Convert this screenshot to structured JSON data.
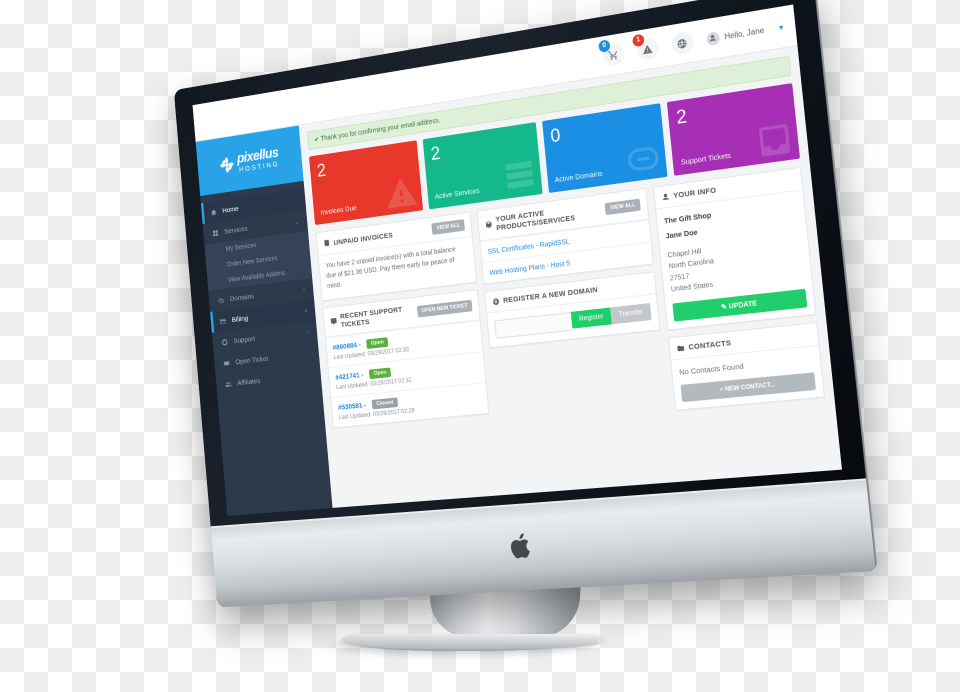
{
  "brand": {
    "name": "pixellus",
    "suffix": "HOSTING",
    "icon": "flower-icon"
  },
  "topbar": {
    "cart": {
      "icon": "shopping-cart-icon",
      "badge": "0"
    },
    "alerts": {
      "icon": "warning-triangle-icon",
      "badge": "1"
    },
    "globe": {
      "icon": "globe-icon"
    },
    "user": {
      "avatar_icon": "user-avatar-icon",
      "greeting": "Hello, Jane",
      "caret": "▾"
    },
    "hamburger": {
      "icon": "hamburger-menu-icon"
    }
  },
  "sidebar": {
    "items": [
      {
        "label": "Home",
        "icon": "home-icon",
        "active": true,
        "chevron": ""
      },
      {
        "label": "Services",
        "icon": "services-grid-icon",
        "active": false,
        "chevron": "⌄"
      },
      {
        "label": "Domains",
        "icon": "globe-pin-icon",
        "active": false,
        "chevron": "›"
      },
      {
        "label": "Billing",
        "icon": "credit-card-icon",
        "active": true,
        "chevron": "›"
      },
      {
        "label": "Support",
        "icon": "lifebuoy-icon",
        "active": false,
        "chevron": "›"
      },
      {
        "label": "Open Ticket",
        "icon": "ticket-icon",
        "active": false,
        "chevron": ""
      },
      {
        "label": "Affiliates",
        "icon": "affiliates-icon",
        "active": false,
        "chevron": ""
      }
    ],
    "submenu": [
      {
        "label": "My Services"
      },
      {
        "label": "Order New Services"
      },
      {
        "label": "View Available Addons"
      }
    ]
  },
  "alert": {
    "icon": "check-icon",
    "text": "Thank you for confirming your email address."
  },
  "stats": [
    {
      "number": "2",
      "label": "Invoices Due",
      "color": "#e8372b",
      "icon": "warning-triangle-icon"
    },
    {
      "number": "2",
      "label": "Active Services",
      "color": "#14b88a",
      "icon": "server-stack-icon"
    },
    {
      "number": "0",
      "label": "Active Domains",
      "color": "#1a8fe3",
      "icon": "link-chain-icon"
    },
    {
      "number": "2",
      "label": "Support Tickets",
      "color": "#a62fb5",
      "icon": "inbox-icon"
    }
  ],
  "unpaid_invoices": {
    "title": "Unpaid Invoices",
    "icon": "invoice-icon",
    "view_all": "View All",
    "body": "You have 2 unpaid invoice(s) with a total balance due of $21.36 USD. Pay them early for peace of mind."
  },
  "recent_tickets": {
    "title": "Recent Support Tickets",
    "icon": "comment-icon",
    "action": "Open New Ticket",
    "rows": [
      {
        "id": "#860884 -",
        "status": "Open",
        "updated": "Last Updated: 03/29/2017 02:33"
      },
      {
        "id": "#421741 -",
        "status": "Open",
        "updated": "Last Updated: 03/29/2017 02:32"
      },
      {
        "id": "#530581 -",
        "status": "Closed",
        "updated": "Last Updated: 03/29/2017 02:29"
      }
    ]
  },
  "active_products": {
    "title": "Your Active Products/Services",
    "icon": "box-icon",
    "view_all": "View All",
    "rows": [
      {
        "label": "SSL Certificates - RapidSSL"
      },
      {
        "label": "Web Hosting Plans - Host 5"
      }
    ]
  },
  "register_domain": {
    "title": "Register a New Domain",
    "icon": "globe-icon",
    "input_value": "",
    "input_placeholder": "",
    "register_label": "Register",
    "transfer_label": "Transfer"
  },
  "your_info": {
    "title": "Your Info",
    "icon": "user-icon",
    "company": "The Gift Shop",
    "name": "Jane Doe",
    "city": "Chapel Hill",
    "state": "North Carolina",
    "zip": "27517",
    "country": "United States",
    "update_label": "✎ Update"
  },
  "contacts": {
    "title": "Contacts",
    "icon": "folder-icon",
    "empty_text": "No Contacts Found",
    "new_label": "+ New Contact..."
  },
  "device": {
    "brand_logo": "apple-logo-icon"
  }
}
